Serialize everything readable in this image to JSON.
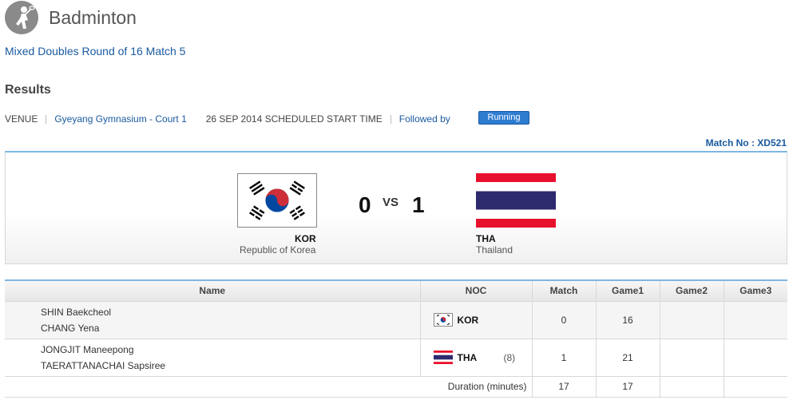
{
  "header": {
    "sport_icon": "badminton-player-icon",
    "sport": "Badminton"
  },
  "subtitle": "Mixed Doubles Round of 16 Match 5",
  "section_title": "Results",
  "info": {
    "venue_label": "VENUE",
    "venue": "Gyeyang Gymnasium - Court 1",
    "date_text": "26 SEP 2014 SCHEDULED START TIME",
    "followed_by": "Followed by",
    "status": "Running"
  },
  "match_no": "Match No : XD521",
  "scoreboard": {
    "score_a": "0",
    "vs": "VS",
    "score_b": "1",
    "team_a": {
      "code": "KOR",
      "name": "Republic of Korea",
      "flag": "korea-flag"
    },
    "team_b": {
      "code": "THA",
      "name": "Thailand",
      "flag": "thailand-flag"
    }
  },
  "table": {
    "headers": [
      "Name",
      "NOC",
      "Match",
      "Game1",
      "Game2",
      "Game3"
    ],
    "rows": [
      {
        "player1": "SHIN Baekcheol",
        "player2": "CHANG Yena",
        "noc": "KOR",
        "seed": "",
        "match": "0",
        "game1": "16",
        "game2": "",
        "game3": ""
      },
      {
        "player1": "JONGJIT Maneepong",
        "player2": "TAERATTANACHAI Sapsiree",
        "noc": "THA",
        "seed": "(8)",
        "match": "1",
        "game1": "21",
        "game2": "",
        "game3": ""
      }
    ],
    "duration": {
      "label": "Duration (minutes)",
      "match": "17",
      "game1": "17",
      "game2": "",
      "game3": ""
    }
  },
  "colors": {
    "link": "#1a5aa0",
    "badge": "#2e7cd0",
    "accent_border": "#7fb7e0",
    "tha_red": "#e8112d",
    "tha_blue": "#2d2a6e",
    "kor_red": "#cd2e3a",
    "kor_blue": "#0047a0"
  }
}
